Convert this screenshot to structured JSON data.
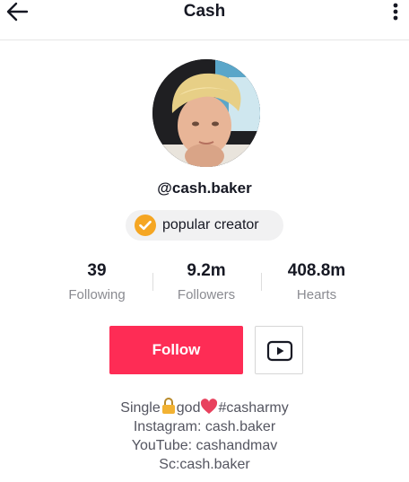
{
  "header": {
    "title": "Cash"
  },
  "profile": {
    "handle": "@cash.baker",
    "badge": "popular creator"
  },
  "stats": [
    {
      "value": "39",
      "label": "Following"
    },
    {
      "value": "9.2m",
      "label": "Followers"
    },
    {
      "value": "408.8m",
      "label": "Hearts"
    }
  ],
  "actions": {
    "follow_label": "Follow"
  },
  "bio": {
    "line1_a": "Single",
    "line1_b": "god",
    "line1_c": "#casharmy",
    "line2": "Instagram: cash.baker",
    "line3": "YouTube: cashandmav",
    "line4": "Sc:cash.baker"
  },
  "colors": {
    "accent": "#fe2c55",
    "badge_orange": "#f5a623",
    "muted": "#8a8b91"
  },
  "icons": {
    "back": "arrow-left-icon",
    "more": "more-vertical-icon",
    "verified": "check-badge-icon",
    "youtube": "youtube-icon",
    "lock": "lock-icon",
    "heart": "heart-icon"
  }
}
